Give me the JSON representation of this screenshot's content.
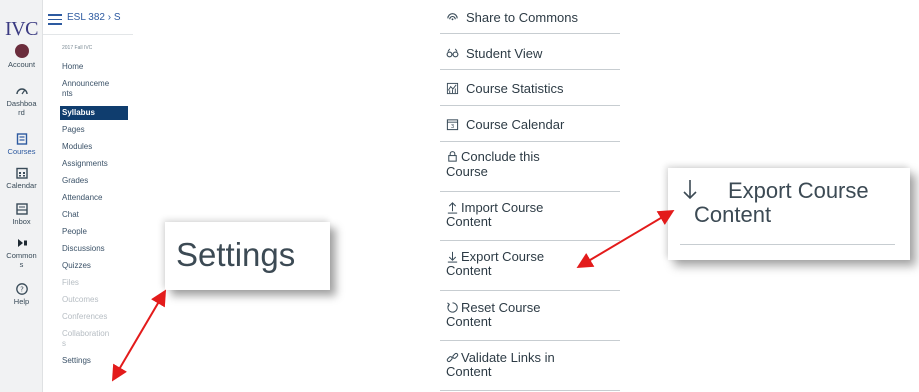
{
  "global_nav": {
    "logo": "IVC",
    "items": [
      {
        "label_lines": [
          "Account"
        ],
        "icon": "avatar-icon"
      },
      {
        "label_lines": [
          "Dashboa",
          "rd"
        ],
        "icon": "dashboard-icon"
      },
      {
        "label_lines": [
          "Courses"
        ],
        "icon": "courses-icon"
      },
      {
        "label_lines": [
          "Calendar"
        ],
        "icon": "calendar-icon"
      },
      {
        "label_lines": [
          "Inbox"
        ],
        "icon": "inbox-icon"
      },
      {
        "label_lines": [
          "Common",
          "s"
        ],
        "icon": "commons-icon"
      },
      {
        "label_lines": [
          "Help"
        ],
        "icon": "help-icon"
      }
    ]
  },
  "header": {
    "breadcrumb": "ESL 382 › S"
  },
  "course_nav": {
    "term": "2017 Fall IVC",
    "items": [
      {
        "label": "Home",
        "state": "normal"
      },
      {
        "label": "Announceme\nnts",
        "state": "normal"
      },
      {
        "label": "Syllabus",
        "state": "active"
      },
      {
        "label": "Pages",
        "state": "normal"
      },
      {
        "label": "Modules",
        "state": "normal"
      },
      {
        "label": "Assignments",
        "state": "normal"
      },
      {
        "label": "Grades",
        "state": "normal"
      },
      {
        "label": "Attendance",
        "state": "normal"
      },
      {
        "label": "Chat",
        "state": "normal"
      },
      {
        "label": "People",
        "state": "normal"
      },
      {
        "label": "Discussions",
        "state": "normal"
      },
      {
        "label": "Quizzes",
        "state": "normal"
      },
      {
        "label": "Files",
        "state": "disabled"
      },
      {
        "label": "Outcomes",
        "state": "disabled"
      },
      {
        "label": "Conferences",
        "state": "disabled"
      },
      {
        "label": "Collaboration\ns",
        "state": "disabled"
      },
      {
        "label": "Settings",
        "state": "normal"
      }
    ]
  },
  "zoom_settings": {
    "label": "Settings"
  },
  "zoom_export": {
    "line1": "Export Course",
    "line2": "Content"
  },
  "course_menu": {
    "items": [
      {
        "icon": "share-icon",
        "lines": [
          "Share to Commons"
        ]
      },
      {
        "icon": "student-view-icon",
        "lines": [
          "Student View"
        ]
      },
      {
        "icon": "statistics-icon",
        "lines": [
          "Course Statistics"
        ]
      },
      {
        "icon": "calendar-icon",
        "lines": [
          "Course Calendar"
        ]
      },
      {
        "icon": "lock-icon",
        "lines": [
          "Conclude this",
          "Course"
        ]
      },
      {
        "icon": "import-icon",
        "lines": [
          "Import Course",
          "Content"
        ]
      },
      {
        "icon": "export-icon",
        "lines": [
          "Export Course",
          "Content"
        ]
      },
      {
        "icon": "reset-icon",
        "lines": [
          "Reset Course",
          "Content"
        ]
      },
      {
        "icon": "link-icon",
        "lines": [
          "Validate Links in",
          "Content"
        ]
      }
    ]
  },
  "colors": {
    "accent": "#2d5aa0",
    "active_nav": "#0f3d6e",
    "arrow": "#e31b1b"
  }
}
